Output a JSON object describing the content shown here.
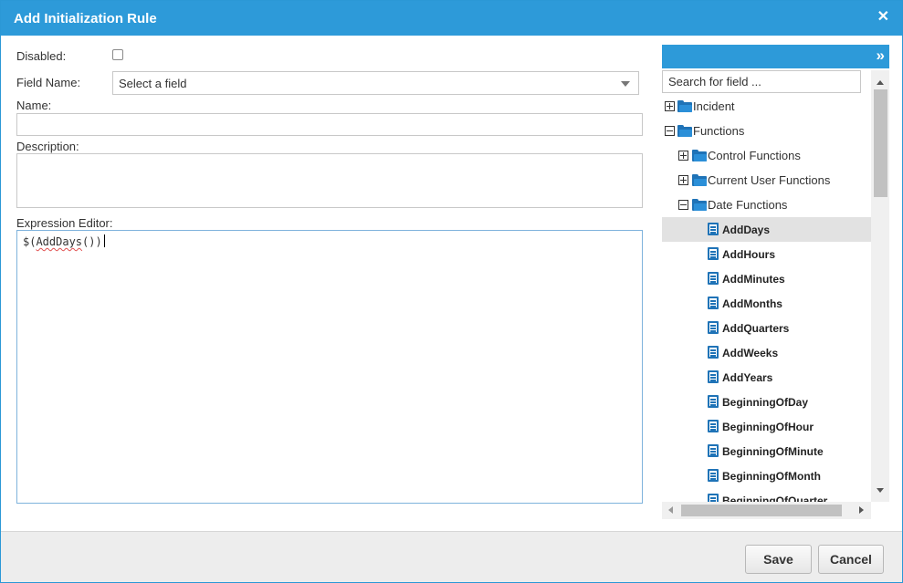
{
  "dialog": {
    "title": "Add Initialization Rule",
    "close_glyph": "✕"
  },
  "form": {
    "disabled_label": "Disabled:",
    "disabled_checked": false,
    "field_name_label": "Field Name:",
    "field_name_value": "Select a field",
    "name_label": "Name:",
    "name_value": "",
    "description_label": "Description:",
    "description_value": "",
    "expression_label": "Expression Editor:",
    "expression_prefix": "$(",
    "expression_func": "AddDays",
    "expression_suffix": "())"
  },
  "panel": {
    "expand_glyph": "»",
    "search_placeholder": "Search for field ...",
    "tree": {
      "incident": "Incident",
      "functions": "Functions",
      "control_functions": "Control Functions",
      "current_user_functions": "Current User Functions",
      "date_functions": "Date Functions",
      "date_items": [
        "AddDays",
        "AddHours",
        "AddMinutes",
        "AddMonths",
        "AddQuarters",
        "AddWeeks",
        "AddYears",
        "BeginningOfDay",
        "BeginningOfHour",
        "BeginningOfMinute",
        "BeginningOfMonth",
        "BeginningOfQuarter"
      ],
      "selected_item": "AddDays"
    }
  },
  "footer": {
    "save_label": "Save",
    "cancel_label": "Cancel"
  },
  "colors": {
    "accent": "#2d9ad9",
    "folder": "#1f73b7"
  }
}
